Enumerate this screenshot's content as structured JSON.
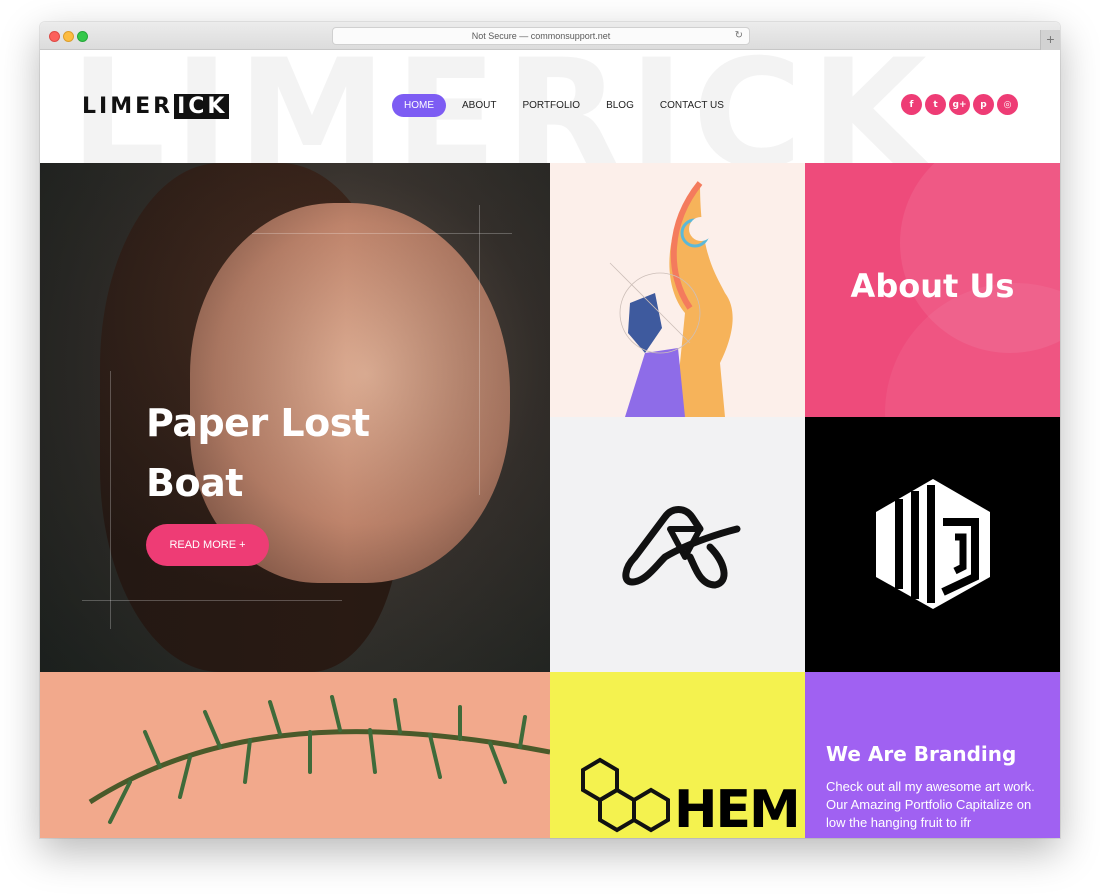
{
  "browser": {
    "url_text": "Not Secure — commonsupport.net",
    "reload_icon": "reload-icon",
    "new_tab_icon": "+"
  },
  "header": {
    "watermark": "LIMERICK",
    "logo_part1": "LIMER",
    "logo_part2": "ICK",
    "nav": [
      {
        "label": "HOME",
        "active": true
      },
      {
        "label": "ABOUT",
        "active": false
      },
      {
        "label": "PORTFOLIO",
        "active": false
      },
      {
        "label": "BLOG",
        "active": false
      },
      {
        "label": "CONTACT US",
        "active": false
      }
    ],
    "social": [
      {
        "icon": "facebook-icon",
        "glyph": "f"
      },
      {
        "icon": "twitter-icon",
        "glyph": "t"
      },
      {
        "icon": "google-plus-icon",
        "glyph": "g+"
      },
      {
        "icon": "pinterest-icon",
        "glyph": "p"
      },
      {
        "icon": "dribbble-icon",
        "glyph": "◎"
      }
    ]
  },
  "hero": {
    "title_line1": "Paper Lost",
    "title_line2": "Boat",
    "button_label": "READ MORE +"
  },
  "about": {
    "title": "About Us"
  },
  "chem": {
    "wordmark": "HEM"
  },
  "branding": {
    "title": "We Are Branding",
    "text": "Check out all my awesome art work. Our Amazing Portfolio Capitalize on low the hanging fruit to ifr"
  },
  "colors": {
    "accent_purple": "#7d5cf3",
    "accent_pink": "#ee3c75",
    "about_bg": "#ee4b7b",
    "brand_bg": "#a061f2",
    "chem_bg": "#f4f24f"
  }
}
